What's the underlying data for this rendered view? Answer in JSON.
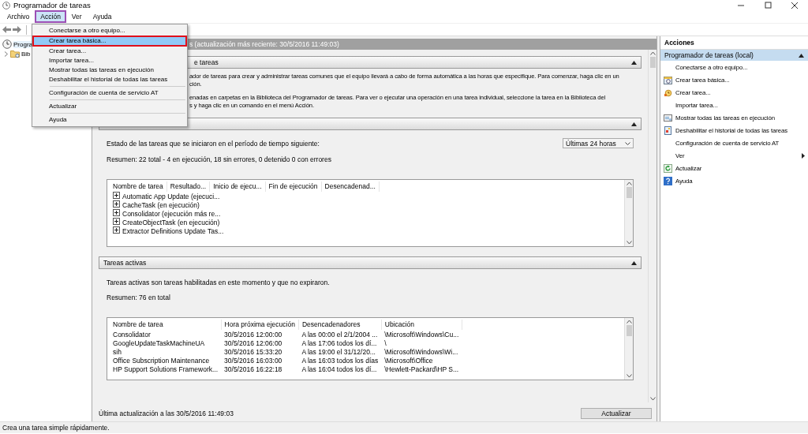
{
  "window": {
    "title": "Programador de tareas"
  },
  "menu_bar": [
    {
      "label": "Archivo",
      "selected": false
    },
    {
      "label": "Acción",
      "selected": true
    },
    {
      "label": "Ver",
      "selected": false
    },
    {
      "label": "Ayuda",
      "selected": false
    }
  ],
  "action_menu": [
    {
      "label": "Conectarse a otro equipo...",
      "selected": false,
      "separator_after": false
    },
    {
      "label": "Crear tarea básica...",
      "selected": true,
      "separator_after": false
    },
    {
      "label": "Crear tarea...",
      "selected": false,
      "separator_after": false
    },
    {
      "label": "Importar tarea...",
      "selected": false,
      "separator_after": false
    },
    {
      "label": "Mostrar todas las tareas en ejecución",
      "selected": false,
      "separator_after": false
    },
    {
      "label": "Deshabilitar el historial de todas las tareas",
      "selected": false,
      "separator_after": true
    },
    {
      "label": "Configuración de cuenta de servicio AT",
      "selected": false,
      "separator_after": true
    },
    {
      "label": "Actualizar",
      "selected": false,
      "separator_after": true
    },
    {
      "label": "Ayuda",
      "selected": false,
      "separator_after": false
    }
  ],
  "tree": [
    {
      "label": "Progra",
      "selected": true,
      "children": [
        {
          "label": "Bib",
          "selected": false,
          "expanded": false
        }
      ]
    }
  ],
  "center": {
    "header": "s (actualización más reciente: 30/5/2016 11:49:03)",
    "overview": {
      "title": "e tareas",
      "paragraphs": [
        [
          "ador de tareas para crear y administrar tareas comunes que el equipo llevará a cabo de forma automática a las horas que especifique. Para comenzar, haga clic en un",
          "ción."
        ],
        [
          "enadas en carpetas en la Biblioteca del Programador de tareas. Para ver o ejecutar una operación en una tarea individual, seleccione la tarea en la Biblioteca del",
          "s y haga clic en un comando en el menú Acción."
        ]
      ]
    },
    "status_panel": {
      "prompt": "Estado de las tareas que se iniciaron en el período de tiempo siguiente:",
      "period": "Últimas 24 horas",
      "summary": "Resumen: 22 total - 4 en ejecución, 18 sin errores, 0 detenido  0 con errores",
      "table": {
        "columns": [
          "Nombre de tarea",
          "Resultado...",
          "Inicio de ejecu...",
          "Fin de ejecución",
          "Desencadenad..."
        ],
        "rows": [
          {
            "name": "Automatic App Update (ejecuci...",
            "expanded": false
          },
          {
            "name": "CacheTask (en ejecución)",
            "expanded": false
          },
          {
            "name": "Consolidator (ejecución más re...",
            "expanded": false
          },
          {
            "name": "CreateObjectTask (en ejecución)",
            "expanded": false
          },
          {
            "name": "Extractor Definitions Update Tas...",
            "expanded": false
          }
        ]
      }
    },
    "active_panel": {
      "title": "Tareas activas",
      "description": "Tareas activas son tareas habilitadas en este momento y que no expiraron.",
      "summary": "Resumen: 76 en total",
      "table": {
        "columns": [
          "Nombre de tarea",
          "Hora próxima ejecución",
          "Desencadenadores",
          "Ubicación"
        ],
        "rows": [
          [
            "Consolidator",
            "30/5/2016 12:00:00",
            "A las 00:00 el 2/1/2004 ...",
            "\\Microsoft\\Windows\\Cu..."
          ],
          [
            "GoogleUpdateTaskMachineUA",
            "30/5/2016 12:06:00",
            "A las 17:06 todos los dí...",
            "\\"
          ],
          [
            "sih",
            "30/5/2016 15:33:20",
            "A las 19:00 el 31/12/20...",
            "\\Microsoft\\Windows\\Wi..."
          ],
          [
            "Office Subscription Maintenance",
            "30/5/2016 16:03:00",
            "A las 16:03 todos los días",
            "\\Microsoft\\Office"
          ],
          [
            "HP Support Solutions Framework...",
            "30/5/2016 16:22:18",
            "A las 16:04 todos los dí...",
            "\\Hewlett-Packard\\HP S..."
          ]
        ]
      }
    },
    "footer": {
      "last_update": "Última actualización a las 30/5/2016 11:49:03",
      "button": "Actualizar"
    }
  },
  "actions": {
    "title": "Acciones",
    "section": "Programador de tareas (local)",
    "items": [
      {
        "label": "Conectarse a otro equipo...",
        "kind": "plain"
      },
      {
        "label": "Crear tarea básica...",
        "kind": "wizard"
      },
      {
        "label": "Crear tarea...",
        "kind": "task"
      },
      {
        "label": "Importar tarea...",
        "kind": "plain"
      },
      {
        "label": "Mostrar todas las tareas en ejecución",
        "kind": "running"
      },
      {
        "label": "Deshabilitar el historial de todas las tareas",
        "kind": "history"
      },
      {
        "label": "Configuración de cuenta de servicio AT",
        "kind": "plain"
      },
      {
        "label": "Ver",
        "kind": "submenu"
      },
      {
        "label": "Actualizar",
        "kind": "refresh"
      },
      {
        "label": "Ayuda",
        "kind": "help"
      }
    ]
  },
  "status_bar": "Crea una tarea simple rápidamente."
}
